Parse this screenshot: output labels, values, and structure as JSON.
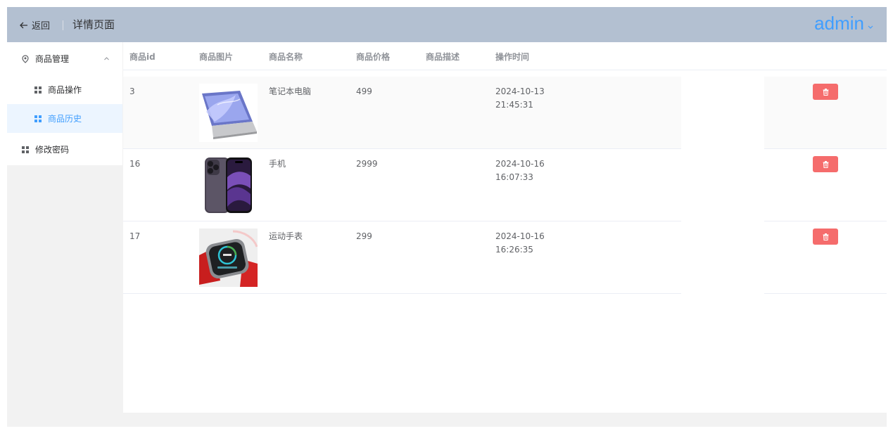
{
  "header": {
    "back_label": "返回",
    "title": "详情页面",
    "user": "admin"
  },
  "sidebar": {
    "items": [
      {
        "label": "商品管理",
        "icon": "location-icon"
      },
      {
        "label": "商品操作",
        "icon": "grid-icon"
      },
      {
        "label": "商品历史",
        "icon": "grid-icon",
        "active": true
      },
      {
        "label": "修改密码",
        "icon": "grid-icon"
      }
    ]
  },
  "table": {
    "columns": [
      "商品id",
      "商品图片",
      "商品名称",
      "商品价格",
      "商品描述",
      "操作时间"
    ],
    "rows": [
      {
        "id": "3",
        "image": "laptop-image",
        "name": "笔记本电脑",
        "price": "499",
        "desc": "",
        "time": "2024-10-13 21:45:31"
      },
      {
        "id": "16",
        "image": "phone-image",
        "name": "手机",
        "price": "2999",
        "desc": "",
        "time": "2024-10-16 16:07:33"
      },
      {
        "id": "17",
        "image": "watch-image",
        "name": "运动手表",
        "price": "299",
        "desc": "",
        "time": "2024-10-16 16:26:35"
      }
    ]
  },
  "colors": {
    "header_bg": "#b3c0d1",
    "accent": "#409eff",
    "danger": "#f56c6c",
    "active_bg": "#ecf5ff"
  }
}
